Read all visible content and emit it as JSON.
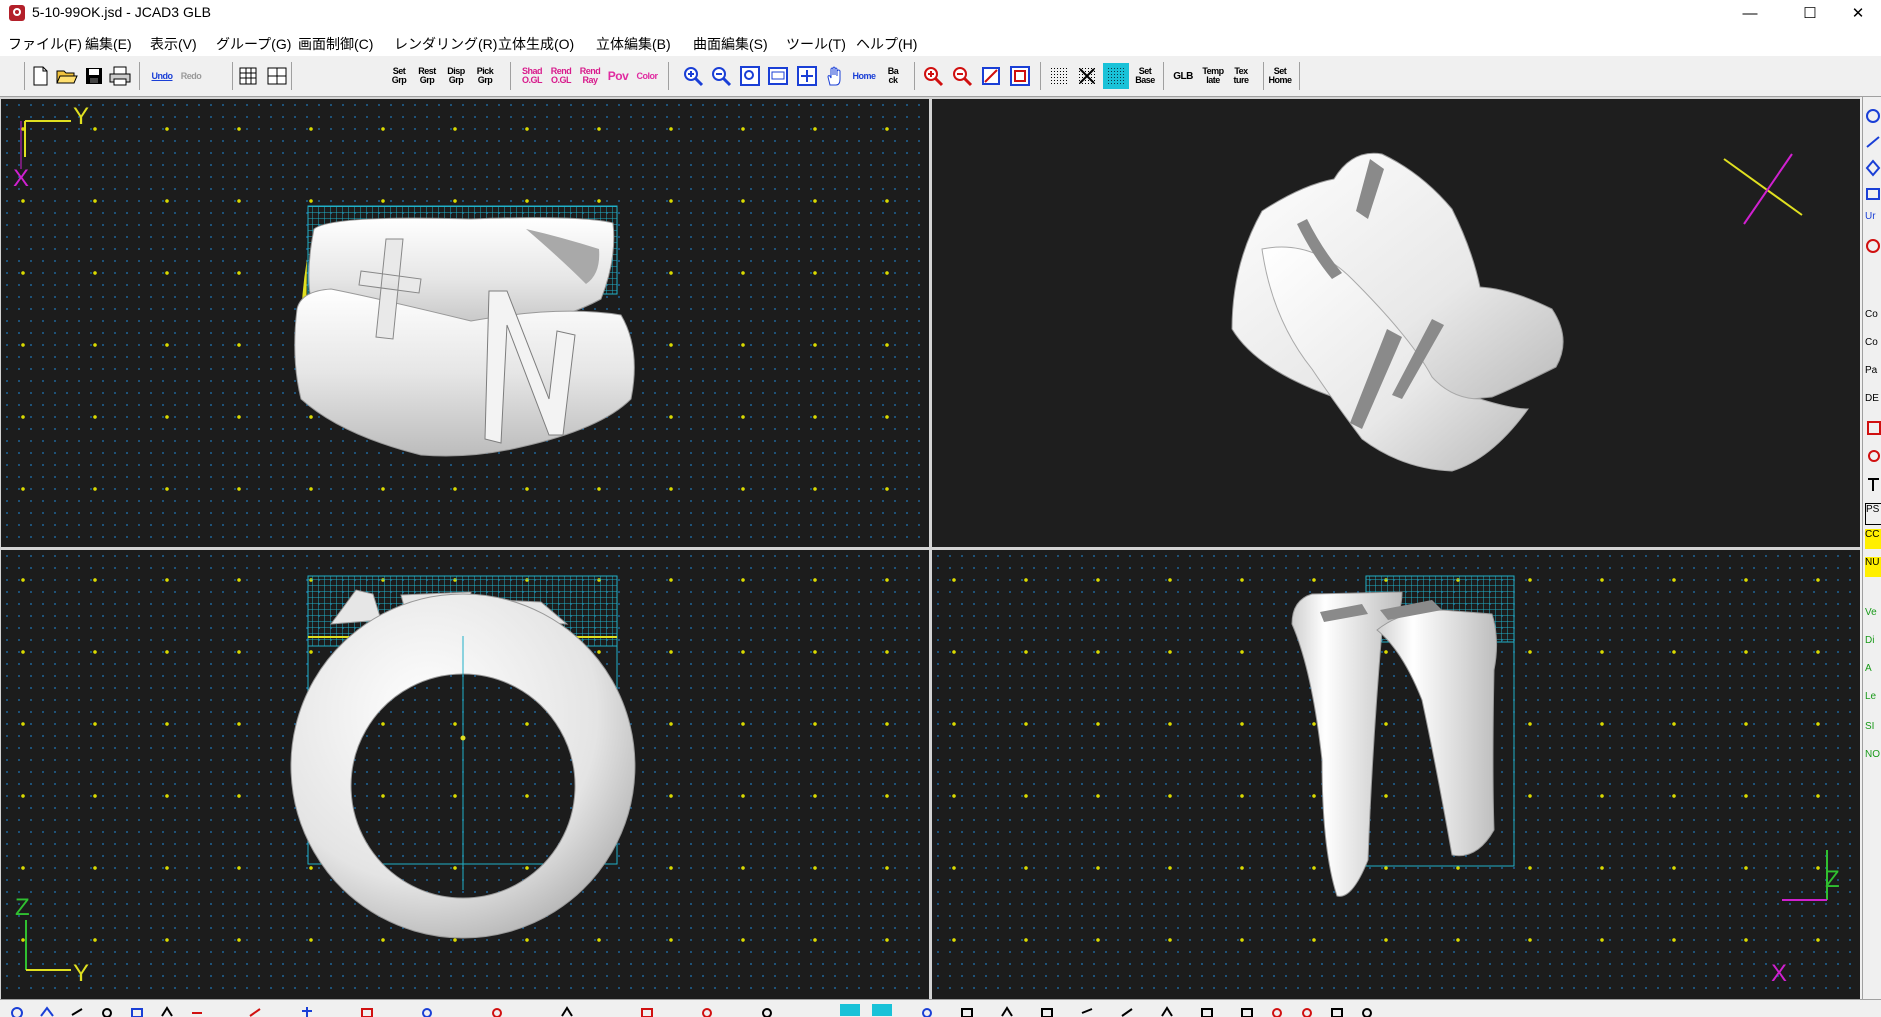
{
  "window": {
    "title": "5-10-99OK.jsd - JCAD3 GLB",
    "minimize": "—",
    "maximize": "☐",
    "close": "✕"
  },
  "menu": [
    "ファイル(F)",
    "編集(E)",
    "表示(V)",
    "グループ(G)",
    "画面制御(C)",
    "レンダリング(R)",
    "立体生成(O)",
    "立体編集(B)",
    "曲面編集(S)",
    "ツール(T)",
    "ヘルプ(H)"
  ],
  "toolbar": {
    "undo": "Undo",
    "redo": "Redo",
    "set_grp": "Set\nGrp",
    "reset_grp": "Rest\nGrp",
    "disp_grp": "Disp\nGrp",
    "pick_grp": "Pick\nGrp",
    "shad_ogl": "Shad\nO.GL",
    "rend_ogl": "Rend\nO.GL",
    "rend_ray": "Rend\nRay",
    "pov": "Pov",
    "color": "Color",
    "home": "Home",
    "back": "Ba\nck",
    "set_base": "Set\nBase",
    "glb": "GLB",
    "template": "Temp\nlate",
    "texture": "Tex\nture",
    "set_home": "Set\nHome"
  },
  "viewports": {
    "top": {
      "axis_y": "Y",
      "axis_x": "X"
    },
    "front": {
      "axis_z": "Z",
      "axis_y": "Y"
    },
    "side": {
      "axis_z": "Z",
      "axis_x": "X"
    }
  },
  "right_panel": [
    "Co",
    "Co",
    "Pa",
    "DE",
    "",
    "",
    "",
    "PS",
    "CC",
    "NU",
    "Ve",
    "Di",
    "A",
    "Le",
    "SI",
    "NO"
  ],
  "colors": {
    "viewport_bg": "#1c1c1c",
    "grid_major": "#dada00",
    "grid_minor": "#1f5f8f",
    "axis_yellow": "#e0e020",
    "axis_magenta": "#d020d0",
    "axis_green": "#30c030",
    "bbox_cyan": "#20b0c8"
  }
}
